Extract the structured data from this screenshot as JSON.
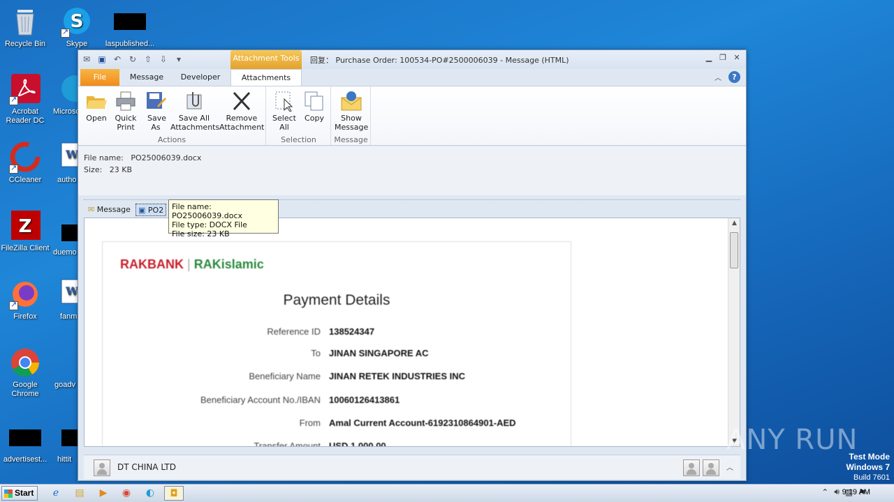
{
  "desktop": {
    "icons": [
      {
        "label": "Recycle Bin"
      },
      {
        "label": "Skype"
      },
      {
        "label": "laspublished..."
      },
      {
        "label": "Acrobat Reader DC"
      },
      {
        "label": "Microsc"
      },
      {
        "label": "CCleaner"
      },
      {
        "label": "autho"
      },
      {
        "label": "FileZilla Client"
      },
      {
        "label": "duemo"
      },
      {
        "label": "Firefox"
      },
      {
        "label": "fanm"
      },
      {
        "label": "Google Chrome"
      },
      {
        "label": "goadv"
      },
      {
        "label": "advertisest..."
      },
      {
        "label": "hittit"
      }
    ]
  },
  "window": {
    "context_tab": "Attachment Tools",
    "title": "Purchase Order: 100534-PO#2500006039 - Message (HTML)",
    "title_prefix": "回复：",
    "tabs": [
      "File",
      "Message",
      "Developer",
      "Attachments"
    ],
    "ribbon": {
      "groups": [
        {
          "name": "Actions",
          "buttons": [
            "Open",
            "Quick Print",
            "Save As",
            "Save All Attachments",
            "Remove Attachment"
          ]
        },
        {
          "name": "Selection",
          "buttons": [
            "Select All",
            "Copy"
          ]
        },
        {
          "name": "Message",
          "buttons": [
            "Show Message"
          ]
        }
      ]
    },
    "file_info": {
      "name_label": "File name:",
      "name_value": "PO25006039.docx",
      "size_label": "Size:",
      "size_value": "23 KB"
    },
    "attachments": {
      "message_label": "Message",
      "file_label": "PO2"
    },
    "tooltip": {
      "line1": "File name:  PO25006039.docx",
      "line2": "File type:  DOCX File",
      "line3": "File size:  23 KB"
    },
    "document": {
      "logo_left": "RAKBANK",
      "logo_right": "RAKislamic",
      "heading": "Payment Details",
      "rows": [
        {
          "key": "Reference ID",
          "value": "138524347"
        },
        {
          "key": "To",
          "value": "JINAN SINGAPORE AC"
        },
        {
          "key": "Beneficiary Name",
          "value": "JINAN RETEK INDUSTRIES INC"
        },
        {
          "key": "Beneficiary Account No./IBAN",
          "value": "10060126413861"
        },
        {
          "key": "From",
          "value": "Amal Current Account-6192310864901-AED"
        },
        {
          "key": "Transfer Amount",
          "value": "USD 1,000.00"
        }
      ]
    },
    "people_bar": {
      "sender": "DT CHINA LTD"
    }
  },
  "watermark": "ANY RUN",
  "os_info": {
    "line1": "Test Mode",
    "line2": "Windows 7",
    "line3": "Build 7601"
  },
  "taskbar": {
    "start_label": "Start",
    "clock": "9:19 AM"
  }
}
